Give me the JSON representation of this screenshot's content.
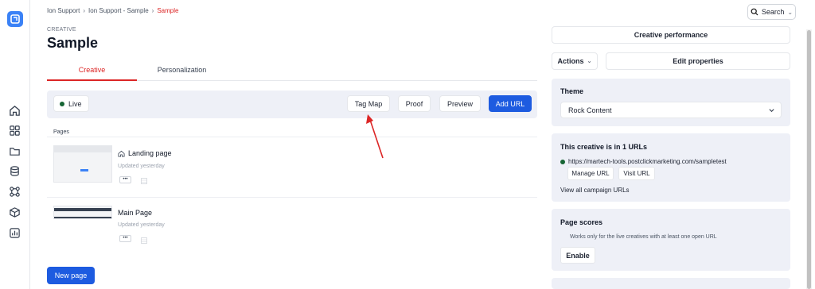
{
  "breadcrumb": [
    "Ion Support",
    "Ion Support - Sample",
    "Sample"
  ],
  "search": {
    "label": "Search"
  },
  "header": {
    "kicker": "CREATIVE",
    "title": "Sample"
  },
  "tabs": [
    {
      "label": "Creative",
      "active": true
    },
    {
      "label": "Personalization",
      "active": false
    }
  ],
  "status": {
    "live_label": "Live",
    "buttons": {
      "tag_map": "Tag Map",
      "proof": "Proof",
      "preview": "Preview",
      "add_url": "Add URL"
    }
  },
  "pages": {
    "label": "Pages",
    "items": [
      {
        "name": "Landing page",
        "updated": "Updated yesterday",
        "icon": "home-icon",
        "more": "•••"
      },
      {
        "name": "Main Page",
        "updated": "Updated yesterday",
        "icon": "",
        "more": "•••"
      }
    ],
    "new_page": "New page"
  },
  "right": {
    "creative_performance": "Creative performance",
    "actions": "Actions",
    "edit_properties": "Edit properties",
    "theme": {
      "title": "Theme",
      "selected": "Rock Content"
    },
    "urls": {
      "title": "This creative is in 1 URLs",
      "url": "https://martech-tools.postclickmarketing.com/sampletest",
      "manage": "Manage URL",
      "visit": "Visit URL",
      "view_all": "View all campaign URLs"
    },
    "scores": {
      "title": "Page scores",
      "note": "Works only for the live creatives with at least one open URL",
      "enable": "Enable"
    }
  },
  "colors": {
    "accent": "#dc2626",
    "primary": "#1d5be0",
    "panel": "#eef0f7",
    "live": "#166534"
  }
}
